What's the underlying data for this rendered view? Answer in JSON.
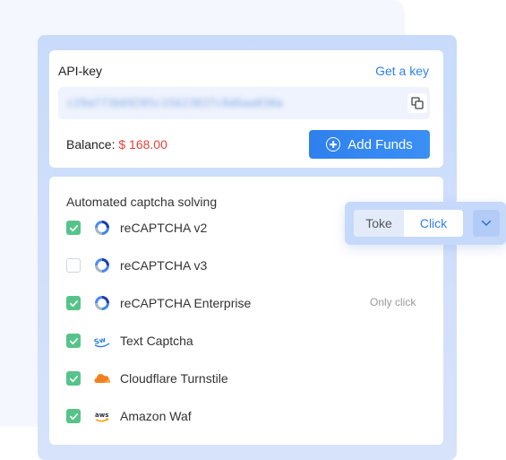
{
  "api": {
    "label": "API-key",
    "get_key_link": "Get a key",
    "key_value": "c29a773b69205c15623837c0d6aa838a"
  },
  "balance": {
    "label": "Balance: ",
    "value": "$ 168.00"
  },
  "add_funds_label": "Add Funds",
  "captcha": {
    "title": "Automated captcha solving",
    "only_click_note": "Only click",
    "items": [
      {
        "label": "reCAPTCHA v2",
        "checked": true,
        "icon": "recaptcha-icon"
      },
      {
        "label": "reCAPTCHA v3",
        "checked": false,
        "icon": "recaptcha-icon"
      },
      {
        "label": "reCAPTCHA Enterprise",
        "checked": true,
        "icon": "recaptcha-icon"
      },
      {
        "label": "Text Captcha",
        "checked": true,
        "icon": "text-captcha-icon"
      },
      {
        "label": "Cloudflare Turnstile",
        "checked": true,
        "icon": "cloudflare-icon"
      },
      {
        "label": "Amazon Waf",
        "checked": true,
        "icon": "aws-icon"
      }
    ]
  },
  "mode_toggle": {
    "option_toke": "Toke",
    "option_click": "Click",
    "selected": "Click"
  },
  "colors": {
    "accent": "#2f80ed",
    "balance_value": "#e5413b",
    "check_green": "#56c48a"
  }
}
